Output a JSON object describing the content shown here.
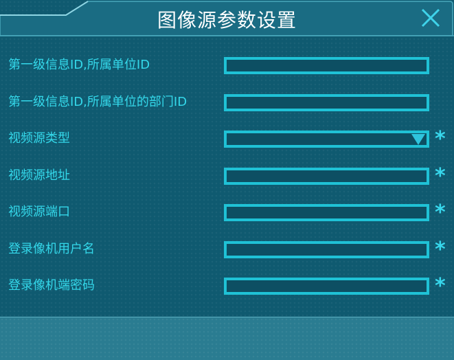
{
  "dialog": {
    "title": "图像源参数设置",
    "close_icon": "close-icon"
  },
  "colors": {
    "background": "#0f5a70",
    "accent": "#1fc2d6",
    "label": "#34d8ea",
    "title": "#ffffff",
    "footer": "#2a7c91"
  },
  "form": {
    "fields": [
      {
        "label": "第一级信息ID,所属单位ID",
        "value": "",
        "required": false,
        "type": "text"
      },
      {
        "label": "第一级信息ID,所属单位的部门ID",
        "value": "",
        "required": false,
        "type": "text"
      },
      {
        "label": "视频源类型",
        "value": "",
        "required": true,
        "type": "select"
      },
      {
        "label": "视频源地址",
        "value": "",
        "required": true,
        "type": "text"
      },
      {
        "label": "视频源端口",
        "value": "",
        "required": true,
        "type": "text"
      },
      {
        "label": "登录像机用户名",
        "value": "",
        "required": true,
        "type": "text"
      },
      {
        "label": "登录像机端密码",
        "value": "",
        "required": true,
        "type": "text"
      }
    ],
    "required_mark": "*"
  }
}
